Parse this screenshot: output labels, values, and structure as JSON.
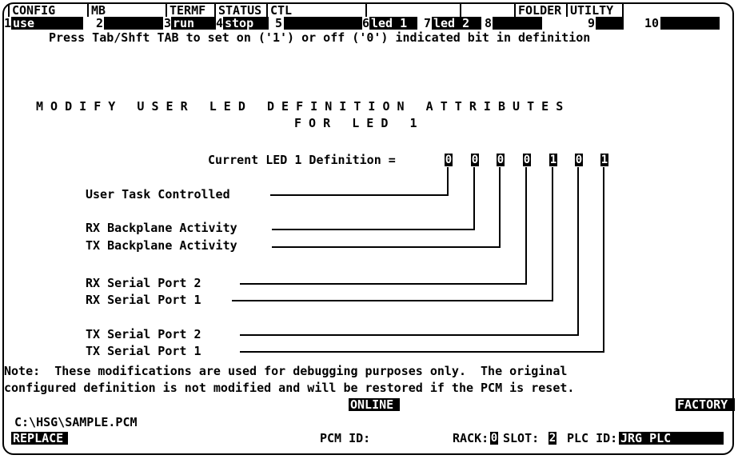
{
  "softkeys": {
    "groups": [
      "CONFIG",
      "MB",
      "TERMF",
      "STATUS",
      "CTL",
      "",
      "",
      "FOLDER",
      "UTILTY"
    ],
    "keys": [
      {
        "num": "1",
        "label": "use"
      },
      {
        "num": "2",
        "label": ""
      },
      {
        "num": "3",
        "label": "run"
      },
      {
        "num": "4",
        "label": "stop"
      },
      {
        "num": "5",
        "label": ""
      },
      {
        "num": "6",
        "label": "led 1"
      },
      {
        "num": "7",
        "label": "led 2"
      },
      {
        "num": "8",
        "label": ""
      },
      {
        "num": "9",
        "label": ""
      },
      {
        "num": "10",
        "label": ""
      }
    ]
  },
  "help_line": "Press Tab/Shft TAB to set on ('1') or off ('0') indicated bit in definition",
  "title": {
    "line1": "M O D I F Y   U S E R   L E D   D E F I N I T I O N   A T T R I B U T E S",
    "line2": "F O R   L E D   1"
  },
  "definition": {
    "label": "Current LED 1 Definition =",
    "bits": [
      "0",
      "0",
      "0",
      "0",
      "1",
      "0",
      "1"
    ]
  },
  "attributes": [
    "User Task Controlled",
    "RX Backplane Activity",
    "TX Backplane Activity",
    "RX Serial Port 2",
    "RX Serial Port 1",
    "TX Serial Port 2",
    "TX Serial Port 1"
  ],
  "note": {
    "line1": "Note:  These modifications are used for debugging purposes only.  The original",
    "line2": "configured definition is not modified and will be restored if the PCM is reset."
  },
  "status": {
    "online": "ONLINE",
    "factory": "FACTORY",
    "path": "C:\\HSG\\SAMPLE.PCM",
    "mode": "REPLACE",
    "pcm_id_label": "PCM ID:",
    "rack_label": "RACK:",
    "rack": "0",
    "slot_label": "SLOT:",
    "slot": "2",
    "plc_id_label": "PLC ID:",
    "plc_id": "JRG PLC"
  }
}
